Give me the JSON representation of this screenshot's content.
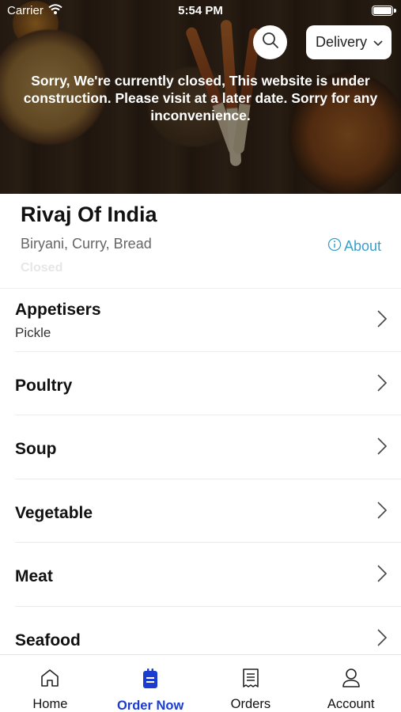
{
  "status_bar": {
    "carrier": "Carrier",
    "time": "5:54 PM"
  },
  "header": {
    "delivery_label": "Delivery",
    "closed_message": "Sorry, We're currently closed, This website is under construction. Please visit at a later date. Sorry for any inconvenience."
  },
  "restaurant": {
    "name": "Rivaj Of India",
    "tags": "Biryani, Curry, Bread",
    "about_label": "About",
    "status": "Closed"
  },
  "categories": [
    {
      "title": "Appetisers",
      "subtitle": "Pickle"
    },
    {
      "title": "Poultry",
      "subtitle": ""
    },
    {
      "title": "Soup",
      "subtitle": ""
    },
    {
      "title": "Vegetable",
      "subtitle": ""
    },
    {
      "title": "Meat",
      "subtitle": ""
    },
    {
      "title": "Seafood",
      "subtitle": ""
    }
  ],
  "tabs": [
    {
      "label": "Home",
      "icon": "home-icon"
    },
    {
      "label": "Order Now",
      "icon": "order-now-icon"
    },
    {
      "label": "Orders",
      "icon": "orders-icon"
    },
    {
      "label": "Account",
      "icon": "account-icon"
    }
  ],
  "colors": {
    "accent": "#1a3ccf",
    "link": "#3aa0c8"
  }
}
